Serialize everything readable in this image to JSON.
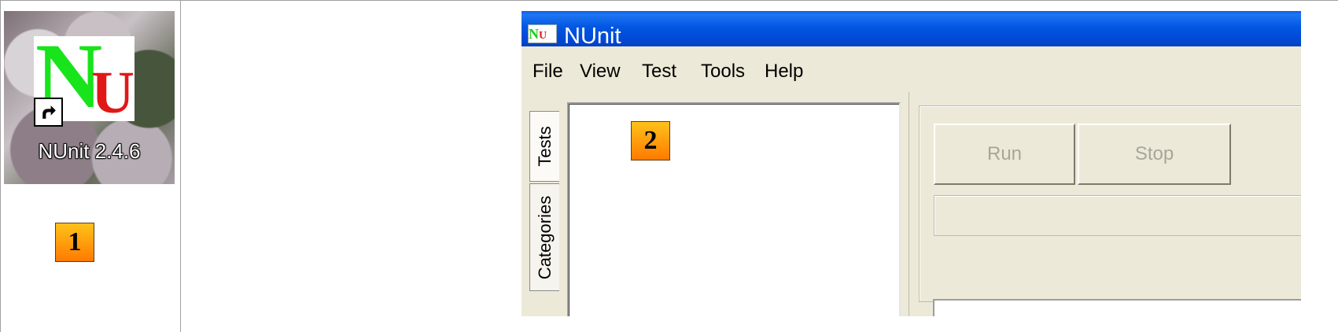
{
  "desktop_icon": {
    "label": "NUnit 2.4.6",
    "logo_n": "N",
    "logo_u": "U",
    "icon": "shortcut-arrow-icon"
  },
  "badges": {
    "one": "1",
    "two": "2"
  },
  "window": {
    "title": "NUnit",
    "title_icon": {
      "n": "N",
      "u": "U"
    },
    "menu": [
      "File",
      "View",
      "Test",
      "Tools",
      "Help"
    ],
    "tabs": {
      "tests": "Tests",
      "categories": "Categories"
    },
    "buttons": {
      "run": "Run",
      "stop": "Stop"
    }
  },
  "colors": {
    "titlebar": "#0157e2",
    "logo_green": "#17e41a",
    "logo_red": "#e01818",
    "badge_top": "#ffc21a",
    "badge_bottom": "#ff7a00"
  }
}
